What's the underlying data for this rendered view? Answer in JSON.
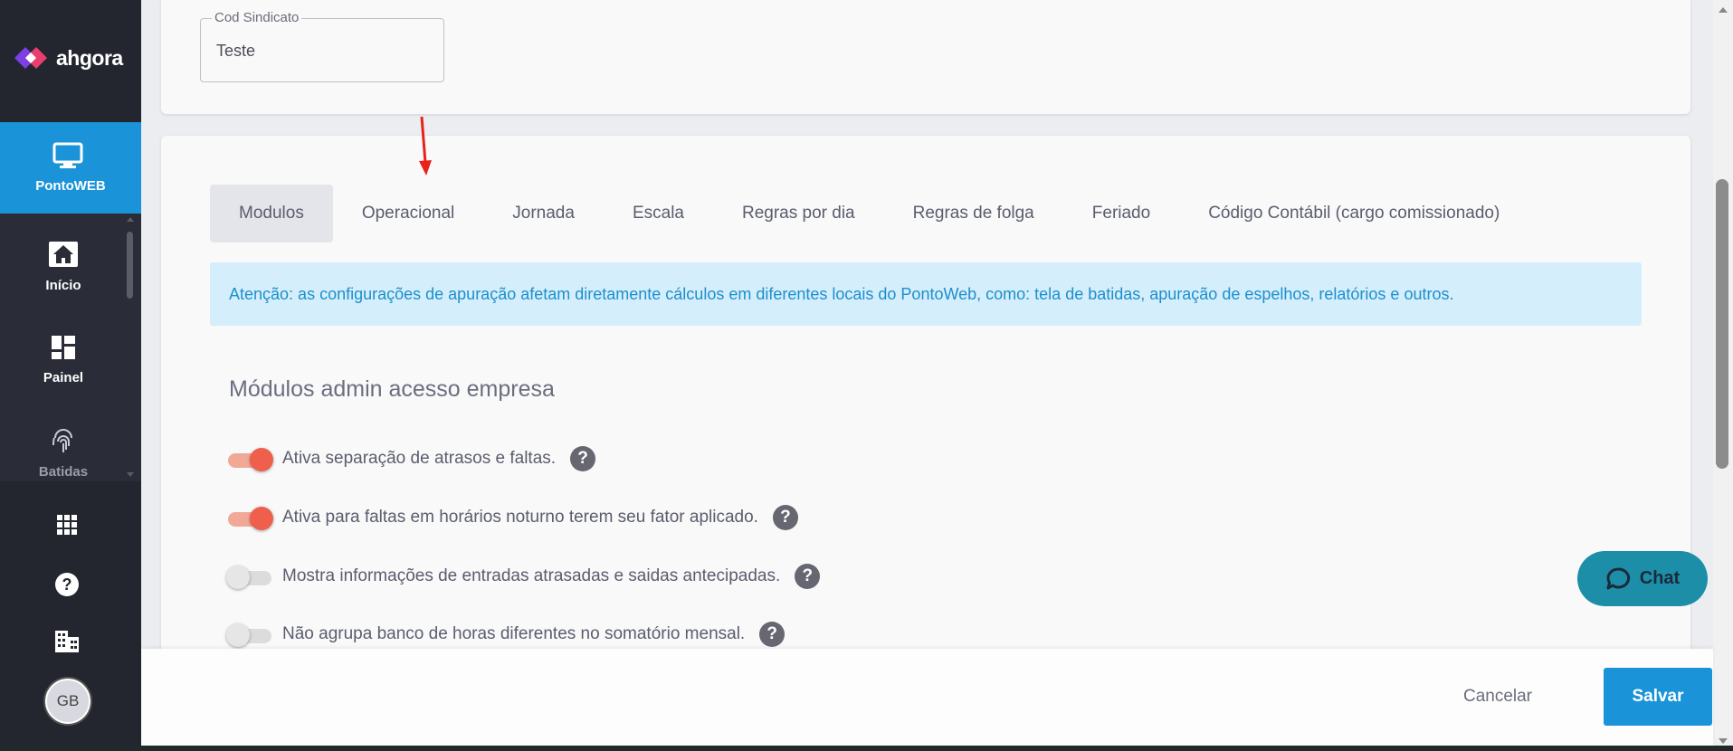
{
  "brand": {
    "name": "ahgora"
  },
  "sidebar": {
    "active": {
      "label": "PontoWEB",
      "icon": "monitor-icon"
    },
    "items": [
      {
        "label": "Início",
        "icon": "home-icon"
      },
      {
        "label": "Painel",
        "icon": "dashboard-icon"
      },
      {
        "label": "Batidas",
        "icon": "fingerprint-icon"
      }
    ],
    "bottom_icons": [
      "apps-grid-icon",
      "help-icon",
      "company-building-icon"
    ],
    "avatar_initials": "GB"
  },
  "sindicato_field": {
    "label": "Cod Sindicato",
    "value": "Teste"
  },
  "tabs": [
    {
      "label": "Modulos",
      "active": true
    },
    {
      "label": "Operacional",
      "active": false
    },
    {
      "label": "Jornada",
      "active": false
    },
    {
      "label": "Escala",
      "active": false
    },
    {
      "label": "Regras por dia",
      "active": false
    },
    {
      "label": "Regras de folga",
      "active": false
    },
    {
      "label": "Feriado",
      "active": false
    },
    {
      "label": "Código Contábil (cargo comissionado)",
      "active": false
    }
  ],
  "alert_text": "Atenção: as configurações de apuração afetam diretamente cálculos em diferentes locais do PontoWeb, como: tela de batidas, apuração de espelhos, relatórios e outros.",
  "section_title": "Módulos admin acesso empresa",
  "options": [
    {
      "label": "Ativa separação de atrasos e faltas.",
      "enabled": true
    },
    {
      "label": "Ativa para faltas em horários noturno terem seu fator aplicado.",
      "enabled": true
    },
    {
      "label": "Mostra informações de entradas atrasadas e saidas antecipadas.",
      "enabled": false
    },
    {
      "label": "Não agrupa banco de horas diferentes no somatório mensal.",
      "enabled": false
    }
  ],
  "chat": {
    "label": "Chat"
  },
  "footer": {
    "cancel": "Cancelar",
    "save": "Salvar"
  },
  "colors": {
    "primary": "#1a93d8",
    "toggle_on": "#ee5f4c",
    "alert_bg": "#d4eefb",
    "chat": "#1c8ea8"
  }
}
